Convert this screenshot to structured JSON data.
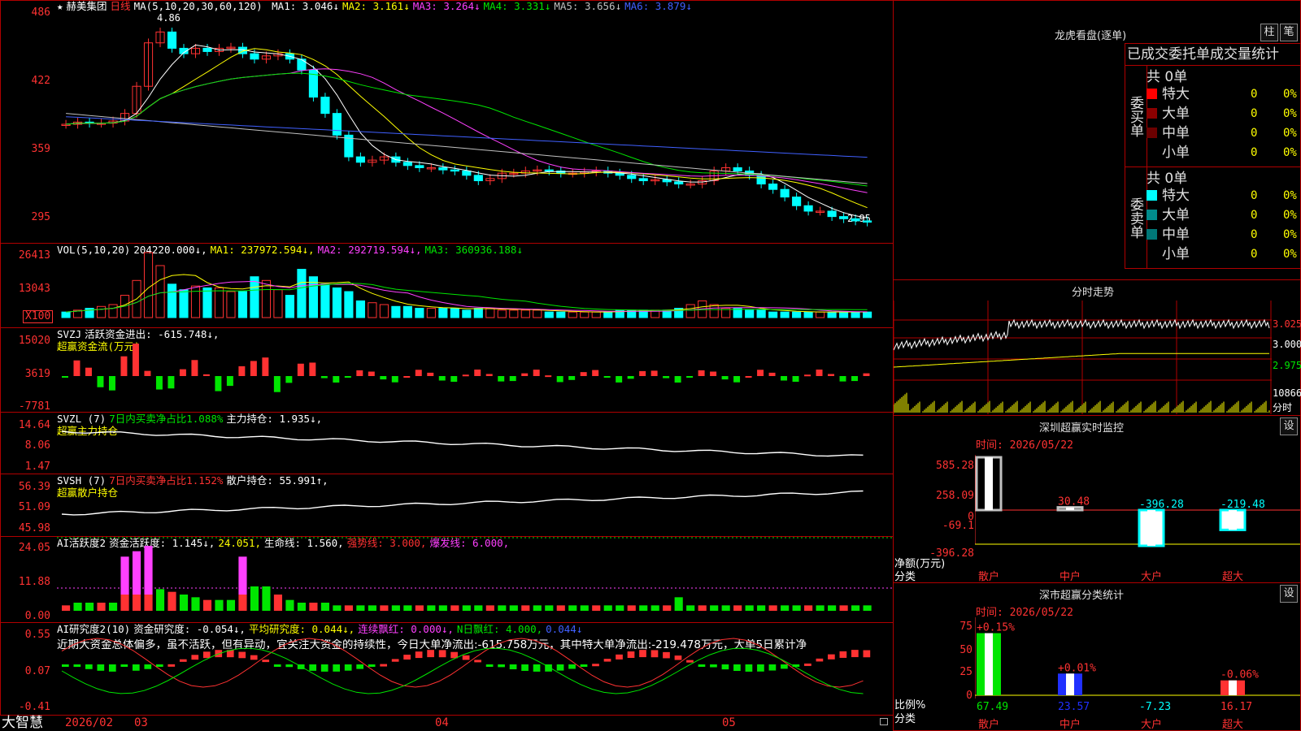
{
  "main": {
    "star": "★",
    "stock_name": "赫美集团",
    "period": "日线",
    "ma_label": "MA(5,10,20,30,60,120)",
    "ma_values": [
      {
        "label": "MA1: 3.046↓",
        "color": "#ffffff"
      },
      {
        "label": "MA2: 3.161↓",
        "color": "#ffff00"
      },
      {
        "label": "MA3: 3.264↓",
        "color": "#ff40ff"
      },
      {
        "label": "MA4: 3.331↓",
        "color": "#00e600"
      },
      {
        "label": "MA5: 3.656↓",
        "color": "#c0c0c0"
      },
      {
        "label": "MA6: 3.879↓",
        "color": "#4060ff"
      }
    ],
    "y_ticks": [
      "486",
      "422",
      "359",
      "295"
    ],
    "high_label": "4.86",
    "low_label": "2.95"
  },
  "vol": {
    "header": "VOL(5,10,20)",
    "v": "204220.000↓,",
    "ma1": "MA1: 237972.594↓,",
    "ma2": "MA2: 292719.594↓,",
    "ma3": "MA3: 360936.188↓",
    "y_ticks": [
      "26413",
      "13043"
    ],
    "unit": "X100"
  },
  "svzj": {
    "header": "SVZJ",
    "label": "活跃资金进出: -615.748↓,",
    "sub": "超赢资金流(万元)",
    "y_ticks": [
      "15020",
      "3619",
      "-7781"
    ]
  },
  "svzl": {
    "header": "SVZL (7)",
    "label1": "7日内买卖净占比1.088%",
    "label2": "主力持仓: 1.935↓,",
    "sub": "超赢主力持仓",
    "y_ticks": [
      "14.64",
      "8.06",
      "1.47"
    ]
  },
  "svsh": {
    "header": "SVSH (7)",
    "label1": "7日内买卖净占比1.152%",
    "label2": "散户持仓: 55.991↑,",
    "sub": "超赢散户持仓",
    "y_ticks": [
      "56.39",
      "51.09",
      "45.98"
    ]
  },
  "ai1": {
    "header": "AI活跃度2",
    "l1": "资金活跃度: 1.145↓,",
    "l2": "24.051,",
    "l3": "生命线: 1.560,",
    "l4": "强势线: 3.000,",
    "l5": "爆发线: 6.000,",
    "y_ticks": [
      "24.05",
      "11.88",
      "0.00"
    ]
  },
  "ai2": {
    "header": "AI研究度2(10)",
    "l1": "资金研究度: -0.054↓,",
    "l2": "平均研究度: 0.044↓,",
    "l3": "连续飘红: 0.000↓,",
    "l4": "N日飘红: 4.000,",
    "l5": "0.044↓",
    "comment": "近期大资金总体偏多，虽不活跃，但有异动，宜关注大资金的持续性，今日大单净流出:-615.758万元，其中特大单净流出:-219.478万元，大单5日累计净",
    "y_ticks": [
      "0.55",
      "0.07",
      "-0.41"
    ]
  },
  "xaxis": {
    "brand": "大智慧",
    "labels": [
      "2026/02",
      "03",
      "04",
      "05"
    ]
  },
  "right": {
    "lhkp_title": "龙虎看盘(逐单)",
    "btn_bar": "柱",
    "btn_tick": "笔",
    "stats_header": "已成交委托单成交量统计",
    "buy_side": "委买单",
    "sell_side": "委卖单",
    "buy_total": "共 0单",
    "sell_total": "共 0单",
    "buy_rows": [
      {
        "label": "特大",
        "count": "0",
        "pct": "0%",
        "color": "#ff0000"
      },
      {
        "label": "大单",
        "count": "0",
        "pct": "0%",
        "color": "#8b0000"
      },
      {
        "label": "中单",
        "count": "0",
        "pct": "0%",
        "color": "#6b0000"
      },
      {
        "label": "小单",
        "count": "0",
        "pct": "0%",
        "color": ""
      }
    ],
    "sell_rows": [
      {
        "label": "特大",
        "count": "0",
        "pct": "0%",
        "color": "#00ffff"
      },
      {
        "label": "大单",
        "count": "0",
        "pct": "0%",
        "color": "#008b8b"
      },
      {
        "label": "中单",
        "count": "0",
        "pct": "0%",
        "color": "#007777"
      },
      {
        "label": "小单",
        "count": "0",
        "pct": "0%",
        "color": ""
      }
    ],
    "fenshi_title": "分时走势",
    "fenshi_ticks": [
      "3.025",
      "3.000",
      "2.975",
      "10866",
      "分时"
    ],
    "monitor_title": "深圳超赢实时监控",
    "monitor_btn": "设",
    "monitor_time": "时间: 2026/05/22",
    "monitor_yticks": [
      "585.28",
      "258.09",
      "0",
      "-69.1",
      "-396.28"
    ],
    "monitor_ylabel": "净额(万元)",
    "monitor_xlabel": "分类",
    "monitor_cats": [
      "散户",
      "中户",
      "大户",
      "超大"
    ],
    "monitor_values": [
      585.28,
      30.48,
      -396.28,
      -219.48
    ],
    "monitor_value_labels": [
      "585.28",
      "30.48",
      "-396.28",
      "-219.48"
    ],
    "class_title": "深市超赢分类统计",
    "class_btn": "设",
    "class_time": "时间: 2026/05/22",
    "class_yticks": [
      "75",
      "50",
      "25",
      "0"
    ],
    "class_ylabel": "比例%",
    "class_xlabel": "分类",
    "class_top_labels": [
      "+0.15%",
      "+0.01%",
      "-0.06%"
    ],
    "class_values": [
      67.49,
      23.57,
      -7.23,
      16.17
    ],
    "class_value_labels": [
      "67.49",
      "23.57",
      "-7.23",
      "16.17"
    ],
    "class_cats": [
      "散户",
      "中户",
      "大户",
      "超大"
    ]
  }
}
